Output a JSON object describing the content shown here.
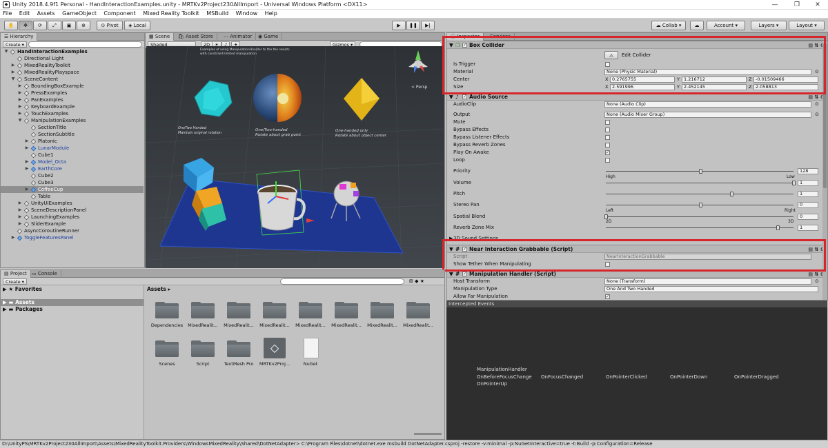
{
  "window": {
    "title": "Unity 2018.4.9f1 Personal - HandInteractionExamples.unity - MRTKv2Project230AllImport - Universal Windows Platform <DX11>"
  },
  "menu": [
    "File",
    "Edit",
    "Assets",
    "GameObject",
    "Component",
    "Mixed Reality Toolkit",
    "MSBuild",
    "Window",
    "Help"
  ],
  "toolbar": {
    "pivot": "Pivot",
    "local": "Local",
    "collab": "Collab ▾",
    "account": "Account",
    "layers": "Layers",
    "layout": "Layout"
  },
  "hierarchy": {
    "tab": "Hierarchy",
    "create": "Create ▾",
    "items": [
      {
        "label": "HandInteractionExamples",
        "depth": 0,
        "arrow": "▼",
        "kind": "scene"
      },
      {
        "label": "Directional Light",
        "depth": 1,
        "arrow": "",
        "kind": "go"
      },
      {
        "label": "MixedRealityToolkit",
        "depth": 1,
        "arrow": "▶",
        "kind": "go"
      },
      {
        "label": "MixedRealityPlayspace",
        "depth": 1,
        "arrow": "▶",
        "kind": "go"
      },
      {
        "label": "SceneContent",
        "depth": 1,
        "arrow": "▼",
        "kind": "go"
      },
      {
        "label": "BoundingBoxExample",
        "depth": 2,
        "arrow": "▶",
        "kind": "go"
      },
      {
        "label": "PressExamples",
        "depth": 2,
        "arrow": "▶",
        "kind": "go"
      },
      {
        "label": "PanExamples",
        "depth": 2,
        "arrow": "▶",
        "kind": "go"
      },
      {
        "label": "KeyboardExample",
        "depth": 2,
        "arrow": "▶",
        "kind": "go"
      },
      {
        "label": "TouchExamples",
        "depth": 2,
        "arrow": "▶",
        "kind": "go"
      },
      {
        "label": "ManipulationExamples",
        "depth": 2,
        "arrow": "▼",
        "kind": "go"
      },
      {
        "label": "SectionTitle",
        "depth": 3,
        "arrow": "",
        "kind": "go"
      },
      {
        "label": "SectionSubtitle",
        "depth": 3,
        "arrow": "",
        "kind": "go"
      },
      {
        "label": "Platonic",
        "depth": 3,
        "arrow": "▶",
        "kind": "go"
      },
      {
        "label": "LunarModule",
        "depth": 3,
        "arrow": "▶",
        "kind": "prefab"
      },
      {
        "label": "Cube1",
        "depth": 3,
        "arrow": "",
        "kind": "go"
      },
      {
        "label": "Model_Octa",
        "depth": 3,
        "arrow": "▶",
        "kind": "prefab"
      },
      {
        "label": "EarthCore",
        "depth": 3,
        "arrow": "▶",
        "kind": "prefab"
      },
      {
        "label": "Cube2",
        "depth": 3,
        "arrow": "",
        "kind": "go"
      },
      {
        "label": "Cube3",
        "depth": 3,
        "arrow": "",
        "kind": "go"
      },
      {
        "label": "CoffeeCup",
        "depth": 3,
        "arrow": "▶",
        "kind": "prefab",
        "selected": true
      },
      {
        "label": "Table",
        "depth": 3,
        "arrow": "",
        "kind": "go"
      },
      {
        "label": "UnityUIExamples",
        "depth": 2,
        "arrow": "▶",
        "kind": "go"
      },
      {
        "label": "SceneDescriptionPanel",
        "depth": 2,
        "arrow": "▶",
        "kind": "go"
      },
      {
        "label": "LaunchingExamples",
        "depth": 2,
        "arrow": "▶",
        "kind": "go"
      },
      {
        "label": "SliderExample",
        "depth": 2,
        "arrow": "▶",
        "kind": "go"
      },
      {
        "label": "AsyncCoroutineRunner",
        "depth": 1,
        "arrow": "",
        "kind": "go"
      },
      {
        "label": "ToggleFeaturesPanel",
        "depth": 1,
        "arrow": "▶",
        "kind": "prefab"
      }
    ]
  },
  "scene_tabs": {
    "scene": "Scene",
    "asset_store": "Asset Store",
    "animator": "Animator",
    "game": "Game",
    "shaded": "Shaded",
    "mode_2d": "2D",
    "gizmos": "Gizmos ▾",
    "persp": "< Persp",
    "banner": "Examples of using ManipulationHandler to the the results\nwith constraint-limited manipulation",
    "labels": {
      "left": "OneTwo Handed\nMaintain original rotation",
      "mid": "One/Two-handed\nRotate about grab point",
      "right": "One-handed only\nRotate about object center"
    }
  },
  "inspector": {
    "tab1": "Inspector",
    "tab2": "Services",
    "box_collider": {
      "title": "Box Collider",
      "edit": "Edit Collider",
      "is_trigger": "Is Trigger",
      "material": "Material",
      "material_value": "None (Physic Material)",
      "center": "Center",
      "center_x": "0.2765755",
      "center_y": "1.216712",
      "center_z": "-0.01509466",
      "size": "Size",
      "size_x": "2.591996",
      "size_y": "2.452145",
      "size_z": "2.058813",
      "x": "X",
      "y": "Y",
      "z": "Z"
    },
    "audio_source": {
      "title": "Audio Source",
      "audio_clip": "AudioClip",
      "audio_clip_value": "None (Audio Clip)",
      "output": "Output",
      "output_value": "None (Audio Mixer Group)",
      "mute": "Mute",
      "bypass_effects": "Bypass Effects",
      "bypass_listener": "Bypass Listener Effects",
      "bypass_reverb": "Bypass Reverb Zones",
      "play_on_awake": "Play On Awake",
      "loop": "Loop",
      "priority": "Priority",
      "priority_value": "128",
      "priority_level": 0.5,
      "high": "High",
      "low": "Low",
      "volume": "Volume",
      "volume_value": "1",
      "pitch": "Pitch",
      "pitch_value": "1",
      "stereo_pan": "Stereo Pan",
      "stereo_value": "0",
      "left": "Left",
      "right": "Right",
      "spatial_blend": "Spatial Blend",
      "spatial_value": "0",
      "twod": "2D",
      "threed": "3D",
      "reverb_mix": "Reverb Zone Mix",
      "reverb_value": "1",
      "sound_settings": "3D Sound Settings"
    },
    "grabbable": {
      "title": "Near Interaction Grabbable (Script)",
      "script": "Script",
      "script_value": "NearInteractionGrabbable",
      "show_tether": "Show Tether When Manipulating"
    },
    "manip": {
      "title": "Manipulation Handler (Script)",
      "host": "Host Transform",
      "host_value": "None (Transform)",
      "type": "Manipulation Type",
      "type_value": "One And Two Handed",
      "far": "Allow Far Manipulation"
    }
  },
  "events": {
    "header": "Intercepted Events",
    "handler": "ManipulationHandler",
    "list": [
      "OnBeforeFocusChange",
      "OnFocusChanged",
      "OnPointerClicked",
      "OnPointerDown",
      "OnPointerDragged",
      "OnPointerUp"
    ]
  },
  "project": {
    "tab": "Project",
    "console": "Console",
    "create": "Create ▾",
    "favorites": "Favorites",
    "assets": "Assets",
    "packages": "Packages",
    "breadcrumb": "Assets ▸",
    "items": [
      "Dependencies",
      "MixedRealit...",
      "MixedRealit...",
      "MixedRealit...",
      "MixedRealit...",
      "MixedRealit...",
      "MixedRealit...",
      "MixedRealit...",
      "Scenes",
      "Script",
      "TextMesh Pro",
      "MRTKv2Proj...",
      "NuGet"
    ]
  },
  "status": "D:\\UnityPS\\MRTKv2Project230AllImport\\Assets\\MixedRealityToolkit.Providers\\WindowsMixedReality\\Shared\\DotNetAdapter> C:\\Program Files\\dotnet\\dotnet.exe msbuild DotNetAdapter.csproj -restore -v:minimal -p:NuGetInteractive=true -t:Build -p:Configuration=Release",
  "colors": {
    "highlight": "#d6252b",
    "prefab": "#1a3f9e"
  }
}
